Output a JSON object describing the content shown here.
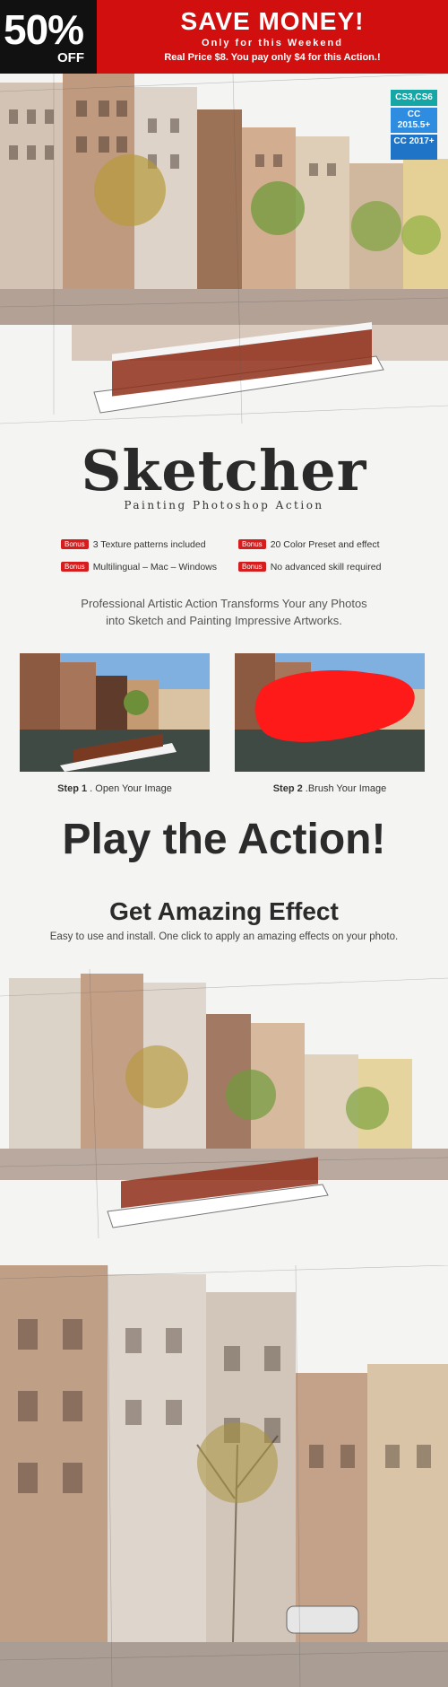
{
  "banner": {
    "percent": "50%",
    "off": "OFF",
    "headline": "SAVE MONEY!",
    "sub1": "Only for this Weekend",
    "sub2": "Real Price $8. You pay only $4 for this Action.!"
  },
  "versions": [
    "CS3,CS6",
    "CC 2015.5+",
    "CC 2017+"
  ],
  "title": "Sketcher",
  "subtitle": "Painting Photoshop Action",
  "features": [
    {
      "bonus": "Bonus",
      "text": "3 Texture patterns included"
    },
    {
      "bonus": "Bonus",
      "text": "20 Color Preset and effect"
    },
    {
      "bonus": "Bonus",
      "text": "Multilingual – Mac – Windows"
    },
    {
      "bonus": "Bonus",
      "text": "No advanced skill required"
    }
  ],
  "description": {
    "line1": "Professional Artistic Action Transforms Your any Photos",
    "line2": "into Sketch and Painting Impressive Artworks."
  },
  "steps": [
    {
      "label": "Step 1",
      "text": " . Open Your Image"
    },
    {
      "label": "Step 2",
      "text": " .Brush Your Image"
    }
  ],
  "play": "Play the Action!",
  "amazing": "Get Amazing Effect",
  "easy": "Easy to use and install. One click to apply an amazing effects on your photo.",
  "colors": {
    "red": "#d10f0f",
    "dark": "#111111",
    "teal": "#15a6a6",
    "blue": "#2e8de0",
    "brush": "#ff1a1a"
  }
}
